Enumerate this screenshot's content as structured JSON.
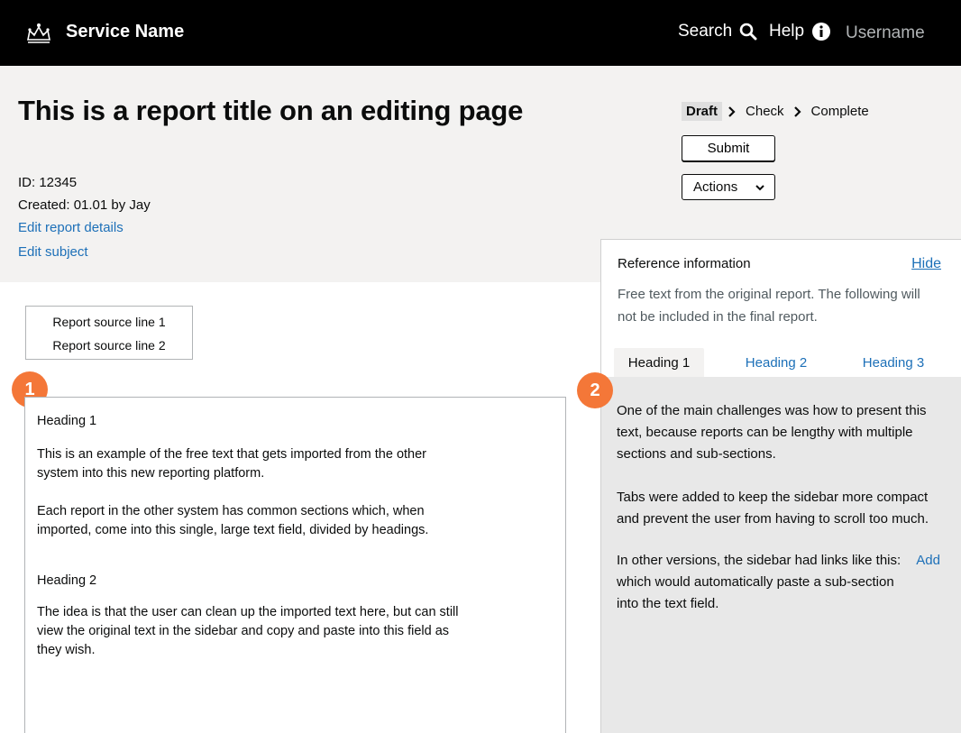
{
  "header": {
    "service_name": "Service Name",
    "search_label": "Search",
    "help_label": "Help",
    "username": "Username"
  },
  "report": {
    "title": "This is a report title on an editing page",
    "id_text": "ID: 12345",
    "created_text": "Created: 01.01 by Jay",
    "edit_details_link": "Edit report details",
    "edit_subject_link": "Edit subject"
  },
  "status_steps": {
    "draft": "Draft",
    "check": "Check",
    "complete": "Complete"
  },
  "buttons": {
    "submit": "Submit",
    "actions": "Actions"
  },
  "source_box": {
    "line1": "Report source line 1",
    "line2": "Report source line 2"
  },
  "markers": {
    "m1": "1",
    "m2": "2"
  },
  "editor": {
    "heading1": "Heading 1",
    "para1": "This is an example of the free text that gets imported from the other system into this new reporting platform.",
    "para2": "Each report in the other system has common sections which, when imported, come into this single, large text field, divided by headings.",
    "heading2": "Heading 2",
    "para3": "The idea is that the user can clean up the imported text here, but can still view the original text in the sidebar and copy and paste into this field as they wish."
  },
  "sidebar": {
    "title": "Reference information",
    "hide_link": "Hide",
    "description": "Free text from the original report. The following will not be included in the final report.",
    "tabs": [
      "Heading 1",
      "Heading 2",
      "Heading 3"
    ],
    "panel": {
      "para1": "One of the main challenges was how to present this text, because reports can be lengthy with multiple sections and sub-sections.",
      "para2": "Tabs were added to keep the sidebar more compact and prevent the user from having to scroll too much.",
      "para3": "In other versions, the sidebar had links like this:",
      "add_link": "Add",
      "para4": "which would automatically paste a sub-section into the text field."
    }
  },
  "colors": {
    "header_bg": "#000000",
    "band_bg": "#f3f2f1",
    "link": "#1d70b8",
    "marker": "#f47738",
    "tab_panel_bg": "#e8e8e8"
  }
}
